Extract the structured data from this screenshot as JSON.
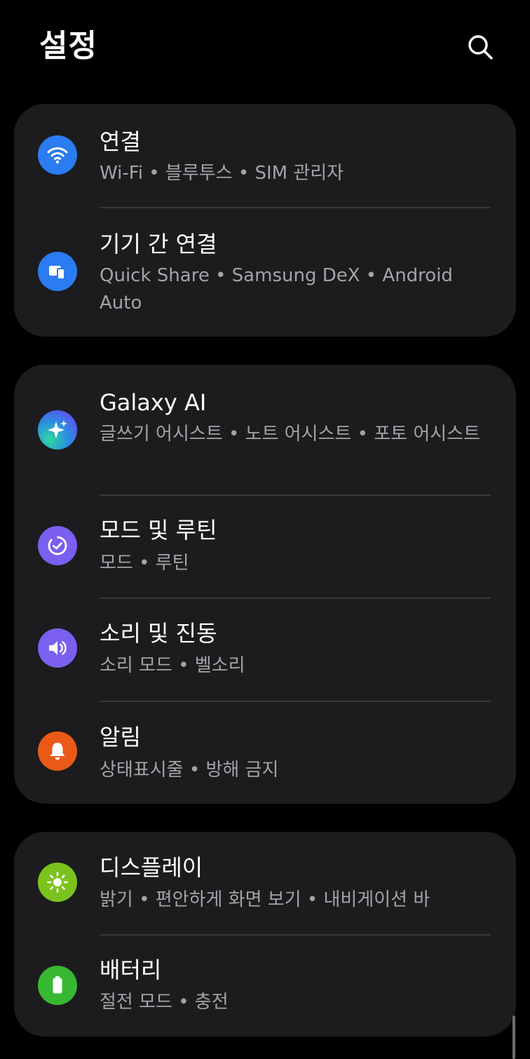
{
  "header": {
    "title": "설정",
    "search_icon": "search-icon"
  },
  "cards": [
    {
      "items": [
        {
          "title": "연결",
          "subtitle": "Wi-Fi • 블루투스 • SIM 관리자",
          "icon": "wifi-icon",
          "color": "#2a7cf0"
        },
        {
          "title": "기기 간 연결",
          "subtitle": "Quick Share • Samsung DeX • Android Auto",
          "icon": "connected-devices-icon",
          "color": "#2a7cf0"
        }
      ]
    },
    {
      "items": [
        {
          "title": "Galaxy AI",
          "subtitle": "글쓰기 어시스트 • 노트 어시스트 • 포토 어시스트",
          "icon": "sparkle-icon",
          "color": "#3b6fe6"
        },
        {
          "title": "모드 및 루틴",
          "subtitle": "모드 • 루틴",
          "icon": "modes-routines-icon",
          "color": "#7a5ff0"
        },
        {
          "title": "소리 및 진동",
          "subtitle": "소리 모드 • 벨소리",
          "icon": "speaker-icon",
          "color": "#7a5ff0"
        },
        {
          "title": "알림",
          "subtitle": "상태표시줄 • 방해 금지",
          "icon": "bell-icon",
          "color": "#ea5a16"
        }
      ]
    },
    {
      "items": [
        {
          "title": "디스플레이",
          "subtitle": "밝기 • 편안하게 화면 보기 • 내비게이션 바",
          "icon": "sun-icon",
          "color": "#7cc21d"
        },
        {
          "title": "배터리",
          "subtitle": "절전 모드 • 충전",
          "icon": "battery-icon",
          "color": "#38b832"
        }
      ]
    }
  ]
}
